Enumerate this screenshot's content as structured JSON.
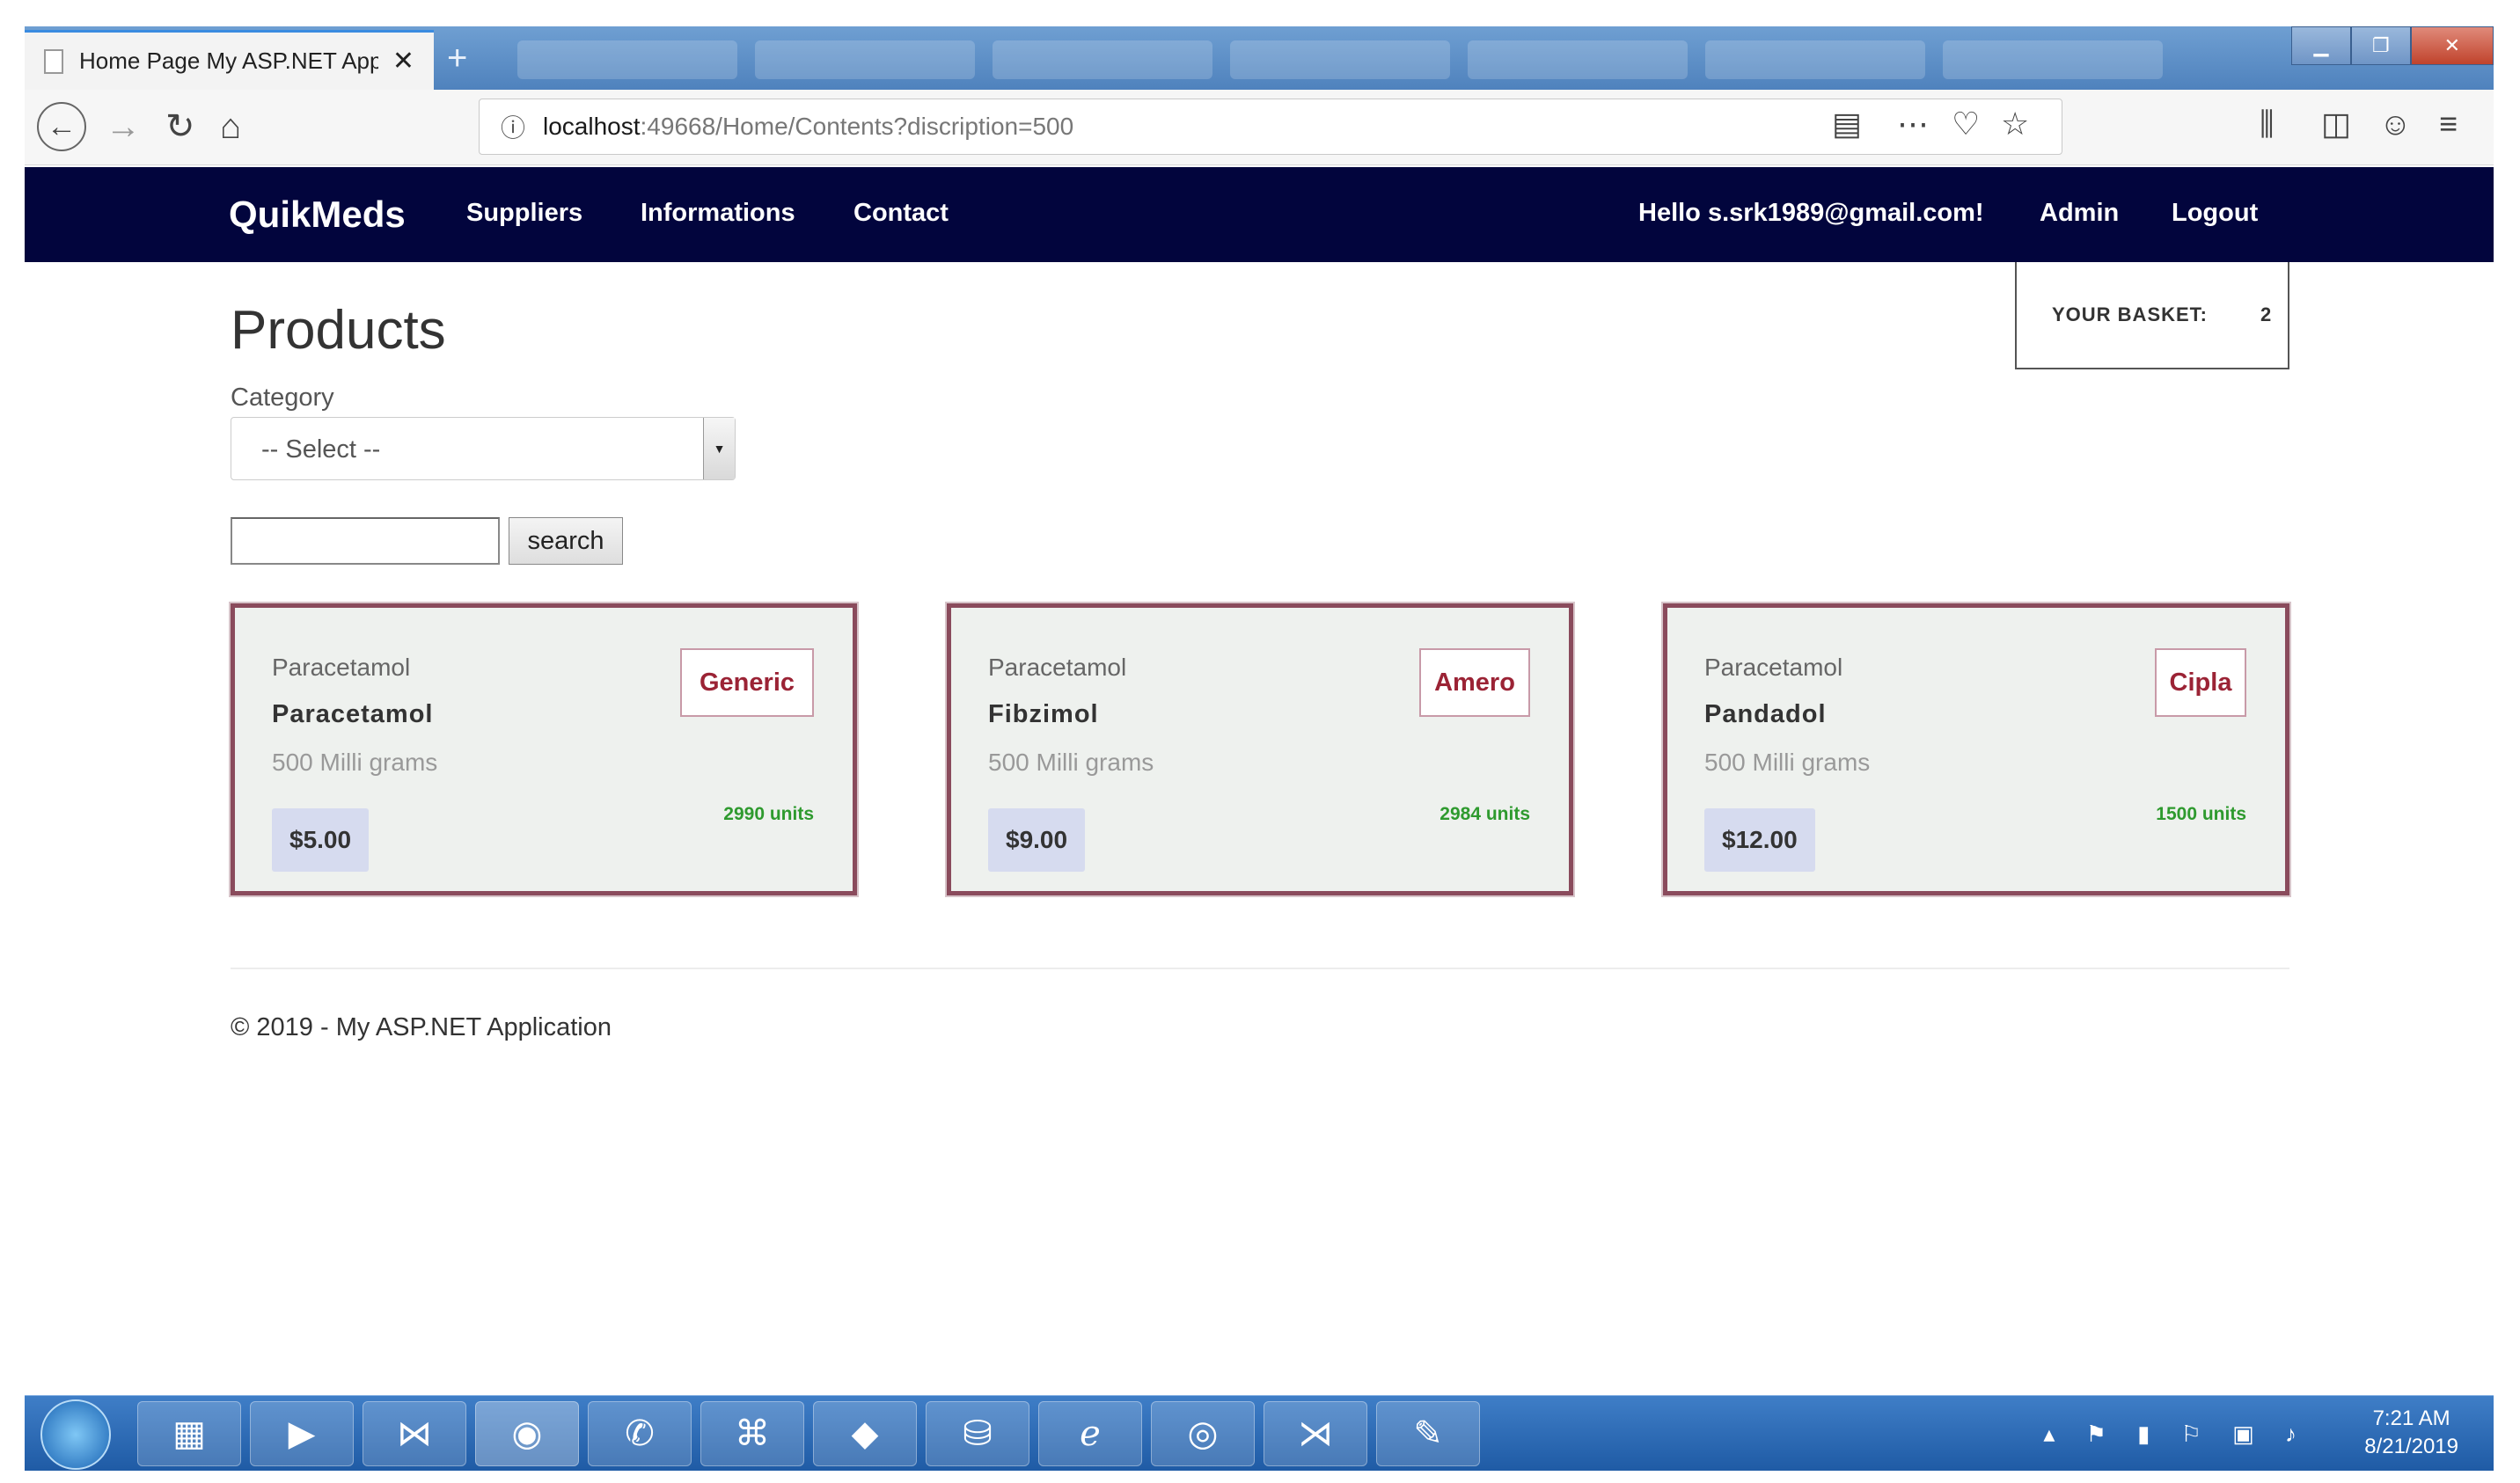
{
  "browser": {
    "tab_title": "Home Page My ASP.NET Appli",
    "tab_close": "✕",
    "new_tab": "+",
    "window_buttons": {
      "minimize": "▁",
      "maximize": "❐",
      "close": "✕"
    },
    "url_host": "localhost",
    "url_path": ":49668/Home/Contents?discription=500"
  },
  "header": {
    "brand": "QuikMeds",
    "nav": [
      "Suppliers",
      "Informations",
      "Contact"
    ],
    "greeting": "Hello s.srk1989@gmail.com!",
    "admin": "Admin",
    "logout": "Logout"
  },
  "basket": {
    "label": "YOUR BASKET:",
    "count": "2"
  },
  "page": {
    "title": "Products",
    "category_label": "Category",
    "category_selected": "-- Select --",
    "search_button": "search"
  },
  "products": [
    {
      "generic": "Paracetamol",
      "name": "Paracetamol",
      "dosage": "500 Milli grams",
      "manufacturer": "Generic",
      "units": "2990 units",
      "price": "$5.00"
    },
    {
      "generic": "Paracetamol",
      "name": "Fibzimol",
      "dosage": "500 Milli grams",
      "manufacturer": "Amero",
      "units": "2984 units",
      "price": "$9.00"
    },
    {
      "generic": "Paracetamol",
      "name": "Pandadol",
      "dosage": "500 Milli grams",
      "manufacturer": "Cipla",
      "units": "1500 units",
      "price": "$12.00"
    }
  ],
  "footer": {
    "text": "© 2019 - My ASP.NET Application"
  },
  "taskbar": {
    "time": "7:21 AM",
    "date": "8/21/2019"
  },
  "colors": {
    "header_bg": "#02053d",
    "card_border": "#8a4b5c",
    "manufacturer_text": "#9b2335",
    "units_text": "#2e9a2e"
  }
}
